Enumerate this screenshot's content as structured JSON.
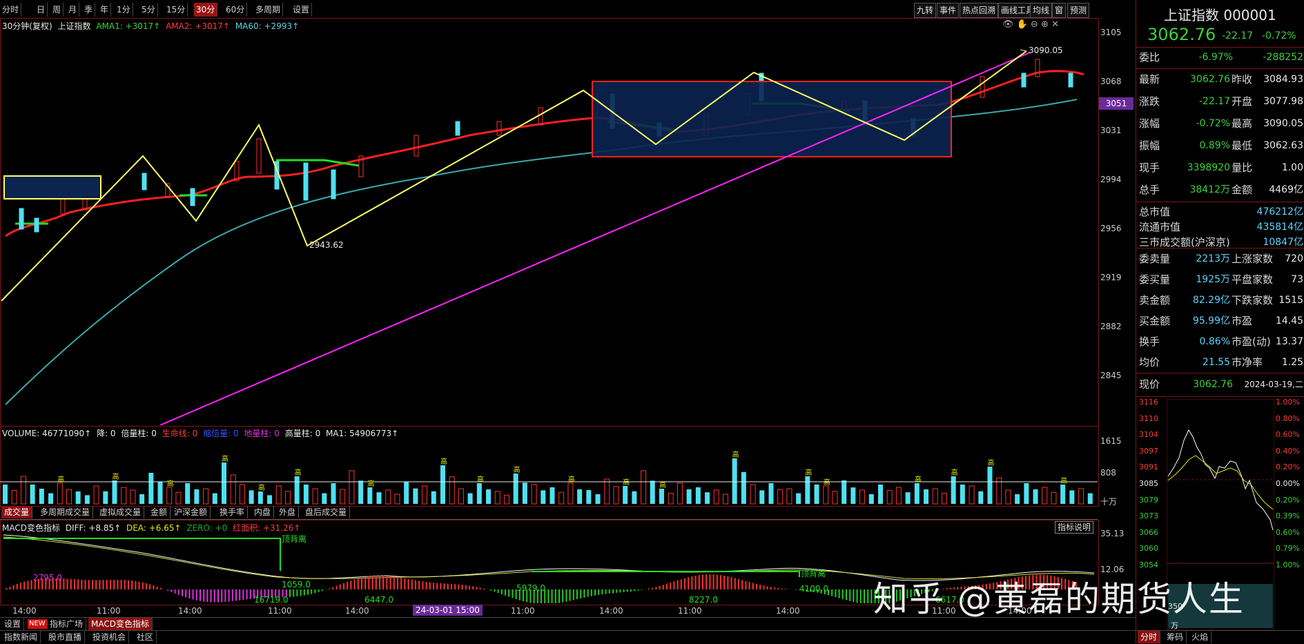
{
  "toolbar": {
    "periods": [
      "分时",
      "日",
      "周",
      "月",
      "季",
      "年",
      "1分",
      "5分",
      "15分",
      "30分",
      "60分",
      "多周期",
      "设置"
    ],
    "active_period": "30分",
    "right_buttons": [
      "九转",
      "事件",
      "热点回溯",
      "画线工具",
      "均线",
      "窗",
      "预测"
    ]
  },
  "main_chart": {
    "legend": {
      "period": "30分钟(复权)",
      "name": "上证指数",
      "ama1": "AMA1: +3017↑",
      "ama2": "AMA2: +3017↑",
      "ma60": "MA60: +2993↑"
    },
    "price_ticks": [
      "3105",
      "3068",
      "3031",
      "2994",
      "2956",
      "2919",
      "2882",
      "2845"
    ],
    "current_price_tag": "3051",
    "annotations": {
      "high": "3090.05",
      "low": "2943.62"
    }
  },
  "volume": {
    "legend": {
      "volume": "VOLUME: 46771090↑",
      "jiang": "降: 0",
      "beiliang": "倍量柱: 0",
      "shengming": "生命线: 0",
      "suoliang": "缩倍量: 0",
      "diliang": "地量柱: 0",
      "gaoliang": "高量柱: 0",
      "ma1": "MA1: 54906773↑"
    },
    "ticks": [
      "1615",
      "808"
    ],
    "unit": "十万",
    "bar_marks": [
      "高",
      "高",
      "高",
      "高",
      "高",
      "高",
      "高",
      "高",
      "高",
      "高",
      "高",
      "高",
      "高",
      "高",
      "高",
      "高",
      "高",
      "高",
      "高",
      "高"
    ],
    "tabs": [
      "成交量",
      "多周期成交量",
      "虚拟成交量",
      "金额",
      "沪深金额",
      "换手率",
      "内盘",
      "外盘",
      "盘后成交量"
    ]
  },
  "macd": {
    "legend": {
      "name": "MACD变色指标",
      "diff": "DIFF: +8.85↑",
      "dea": "DEA: +6.65↑",
      "zero": "ZERO: +0",
      "red_area": "红面积: +31.26↑"
    },
    "explain_button": "指标说明",
    "ticks": [
      "35.13",
      "12.06"
    ],
    "divergence_labels": [
      "顶背离",
      "顶背离"
    ],
    "values": [
      "2795.0",
      "16719.0",
      "1059.0",
      "6447.0",
      "5979.0",
      "8227.0",
      "4100.0",
      "6617.0"
    ]
  },
  "time_axis": {
    "labels": [
      "14:00",
      "11:00",
      "14:00",
      "11:00",
      "14:00",
      "11:00",
      "14:00",
      "11:00",
      "14:00",
      "11:00",
      "14:00"
    ],
    "cursor_label": "24-03-01 15:00"
  },
  "bottom_tabs": {
    "row1": [
      "设置",
      "NEW",
      "指标广场",
      "MACD变色指标"
    ],
    "row2": [
      "指数新闻",
      "股市直播",
      "投资机会",
      "社区"
    ]
  },
  "quote": {
    "title": "上证指数 000001",
    "price": "3062.76",
    "change": "-22.17",
    "change_pct": "-0.72%",
    "weibi": {
      "label": "委比",
      "value": "-6.97%",
      "extra": "-288252"
    },
    "rows": [
      {
        "k1": "最新",
        "v1": "3062.76",
        "k2": "昨收",
        "v2": "3084.93"
      },
      {
        "k1": "涨跌",
        "v1": "-22.17",
        "k2": "开盘",
        "v2": "3077.98"
      },
      {
        "k1": "涨幅",
        "v1": "-0.72%",
        "k2": "最高",
        "v2": "3090.05"
      },
      {
        "k1": "振幅",
        "v1": "0.89%",
        "k2": "最低",
        "v2": "3062.63"
      },
      {
        "k1": "现手",
        "v1": "3398920",
        "k2": "量比",
        "v2": "1.00"
      },
      {
        "k1": "总手",
        "v1": "38412万",
        "k2": "金额",
        "v2": "4469亿"
      }
    ],
    "market": [
      {
        "k": "总市值",
        "v": "476212亿"
      },
      {
        "k": "流通市值",
        "v": "435814亿"
      },
      {
        "k": "三市成交额(沪深京)",
        "v": "10847亿"
      }
    ],
    "rows2": [
      {
        "k1": "委卖量",
        "v1": "2213万",
        "k2": "上涨家数",
        "v2": "720"
      },
      {
        "k1": "委买量",
        "v1": "1925万",
        "k2": "平盘家数",
        "v2": "73"
      },
      {
        "k1": "卖金额",
        "v1": "82.29亿",
        "k2": "下跌家数",
        "v2": "1515"
      },
      {
        "k1": "买金额",
        "v1": "95.99亿",
        "k2": "市盈",
        "v2": "14.45"
      },
      {
        "k1": "换手",
        "v1": "0.86%",
        "k2": "市盈(动)",
        "v2": "13.37"
      },
      {
        "k1": "均价",
        "v1": "21.55",
        "k2": "市净率",
        "v2": "1.25"
      }
    ],
    "now": {
      "label": "现价",
      "value": "3062.76",
      "date": "2024-03-19,二"
    },
    "mini_left_ticks": [
      "3116",
      "3110",
      "3104",
      "3097",
      "3091",
      "3085",
      "3079",
      "3073",
      "3066",
      "3060",
      "3054"
    ],
    "mini_right_ticks": [
      "1.00%",
      "0.80%",
      "0.60%",
      "0.40%",
      "0.20%",
      "0.00%",
      "0.20%",
      "0.39%",
      "0.60%",
      "0.79%",
      "1.00%"
    ],
    "mini_vol_ticks": [
      "350",
      "万"
    ],
    "tabs": [
      "分时",
      "筹码",
      "火焰"
    ]
  },
  "watermark": "知乎 @黄磊的期货人生"
}
